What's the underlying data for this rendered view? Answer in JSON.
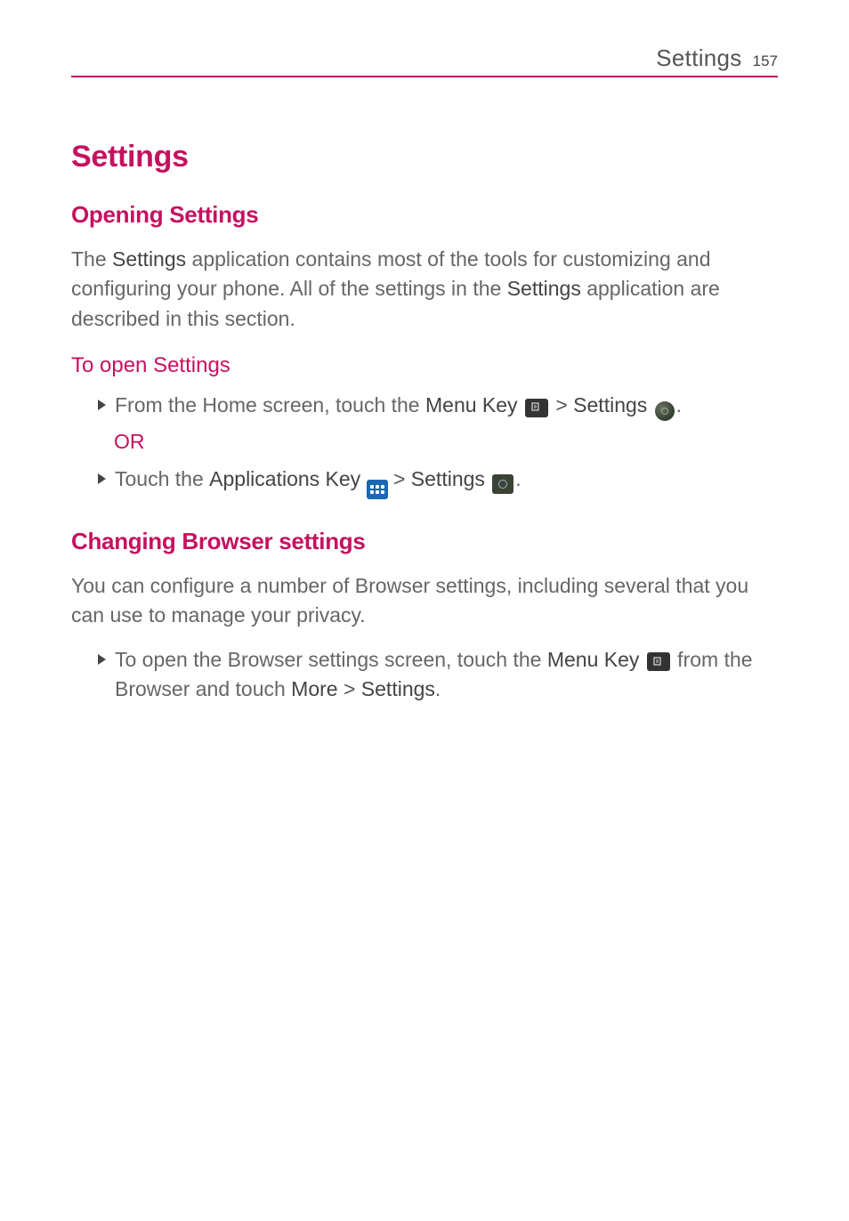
{
  "header": {
    "section": "Settings",
    "page_number": "157"
  },
  "h1": "Settings",
  "opening": {
    "heading": "Opening Settings",
    "para_parts": {
      "p1": "The ",
      "b1": "Settings",
      "p2": " application contains most of the tools for customizing and configuring your phone. All of the settings in the ",
      "b2": "Settings",
      "p3": " application are described in this section."
    },
    "subheading": "To open Settings",
    "step1": {
      "t1": "From the Home screen, touch the ",
      "b1": "Menu Key",
      "gt": " > ",
      "b2": "Settings",
      "end": "."
    },
    "or": "OR",
    "step2": {
      "t1": "Touch the ",
      "b1": "Applications Key",
      "gt": " > ",
      "b2": "Settings",
      "end": "."
    }
  },
  "browser": {
    "heading": "Changing Browser settings",
    "para": "You can configure a number of Browser settings, including several that you can use to manage your privacy.",
    "step": {
      "t1": "To open the Browser settings screen, touch the ",
      "b1": "Menu Key",
      "t2": " from the Browser and touch ",
      "b2": "More",
      "gt": " > ",
      "b3": "Settings",
      "end": "."
    }
  }
}
